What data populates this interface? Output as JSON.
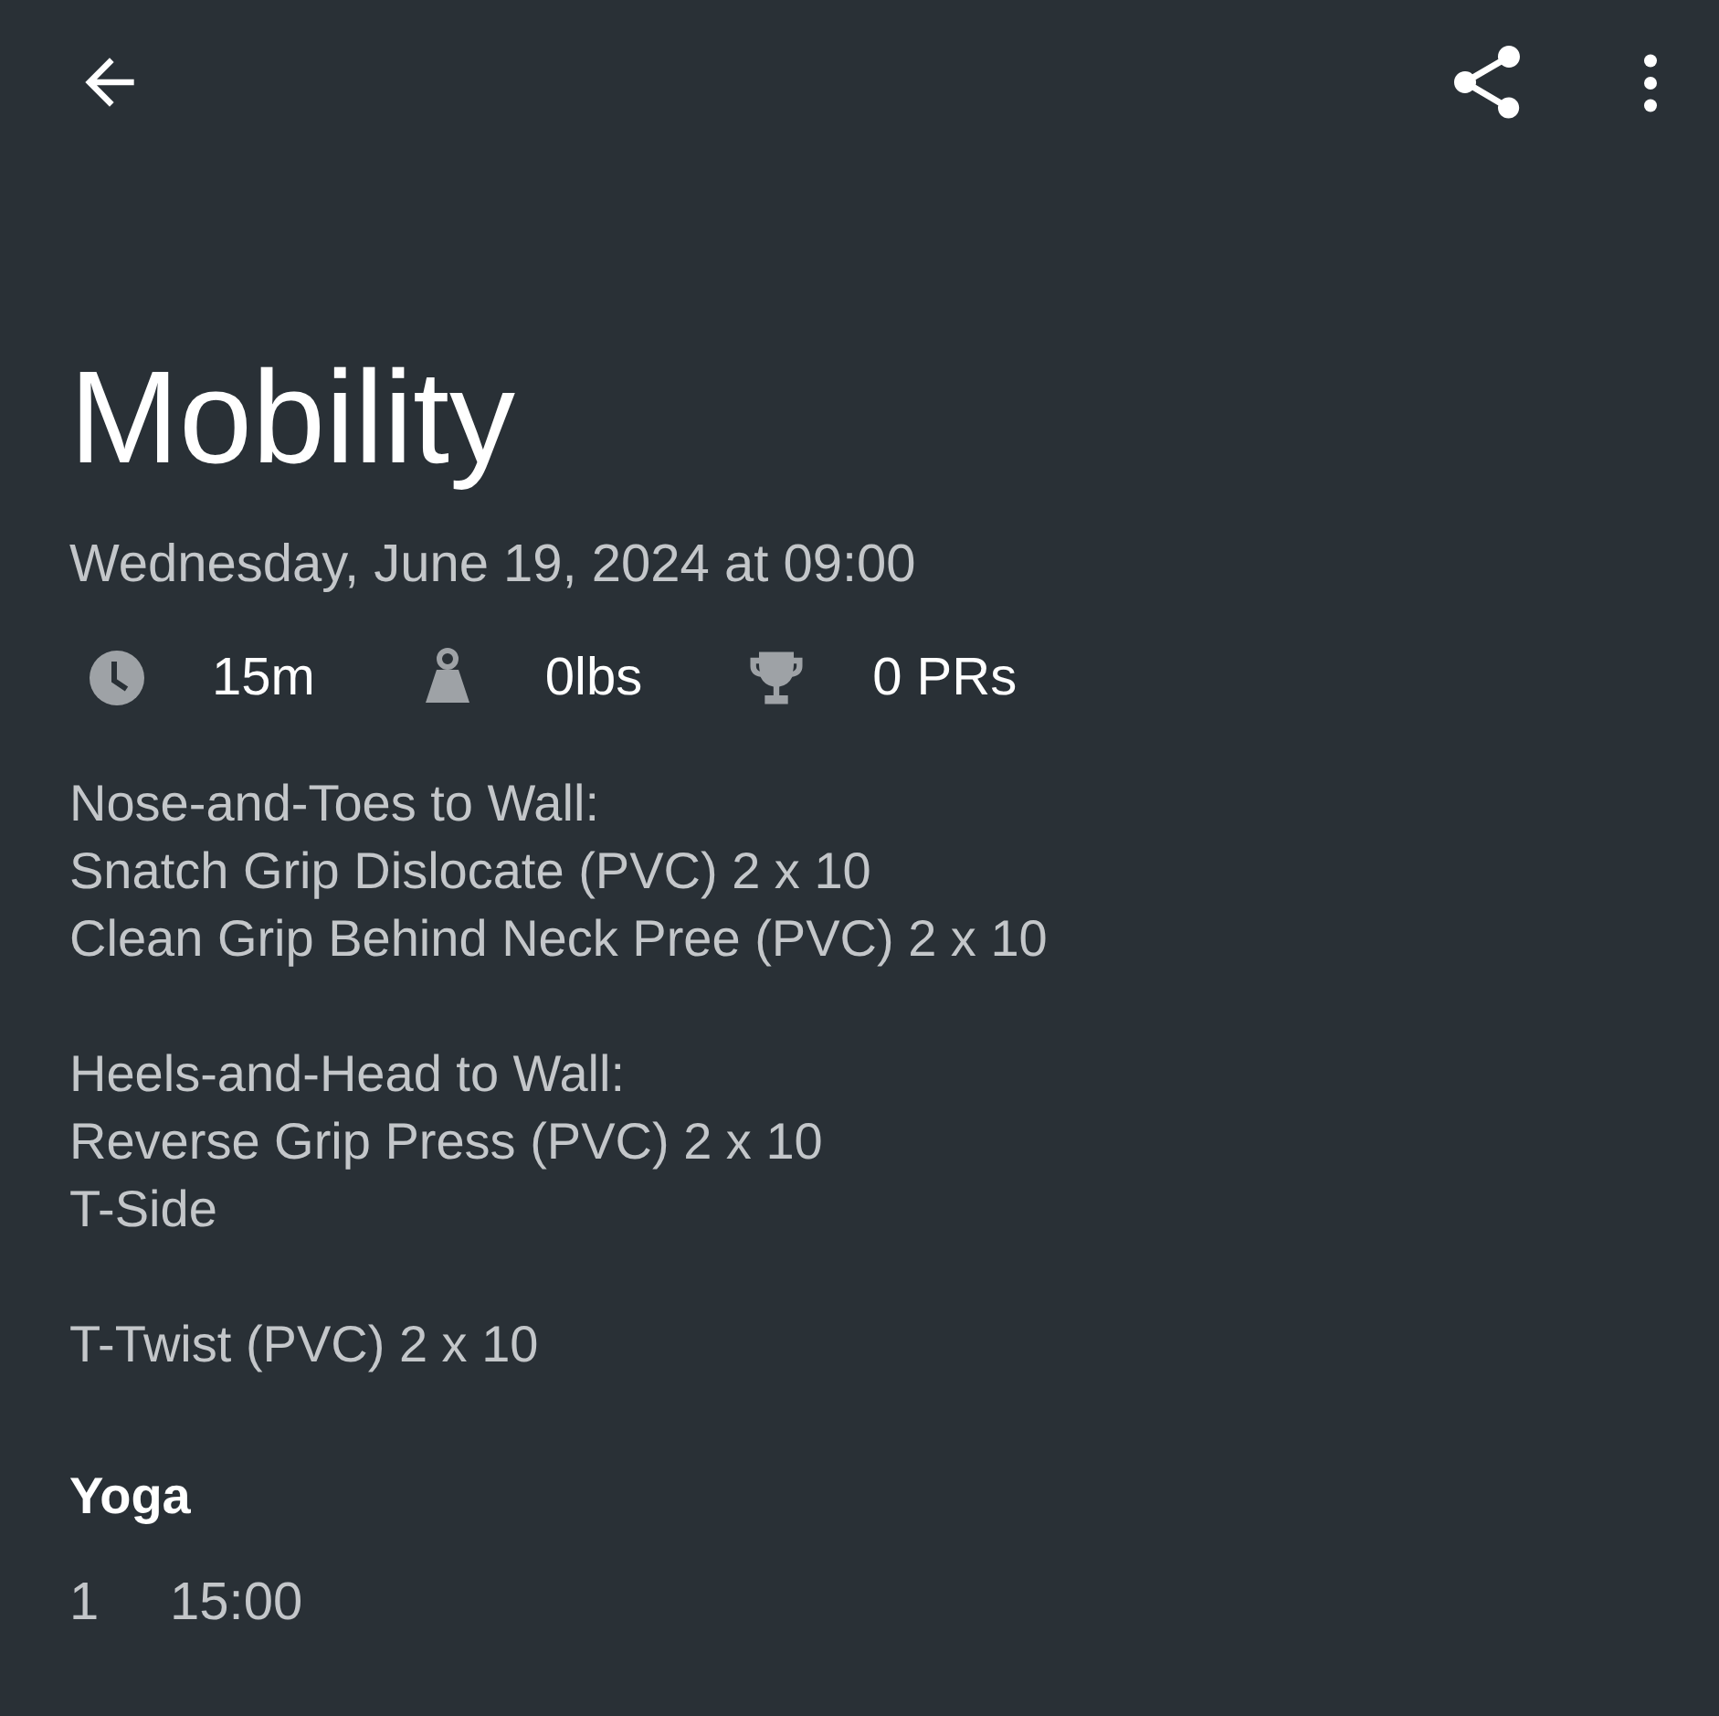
{
  "title": "Mobility",
  "date": "Wednesday, June 19, 2024 at 09:00",
  "stats": [
    {
      "kind": "clock",
      "value": "15m"
    },
    {
      "kind": "weight",
      "value": "0lbs"
    },
    {
      "kind": "trophy",
      "value": "0 PRs"
    }
  ],
  "notes": [
    [
      "Nose-and-Toes to Wall:",
      "Snatch Grip Dislocate (PVC) 2 x 10",
      "Clean Grip Behind Neck Pree (PVC) 2 x 10"
    ],
    [
      "Heels-and-Head to Wall:",
      "Reverse Grip Press (PVC) 2 x 10",
      "T-Side"
    ],
    [
      "T-Twist (PVC) 2 x 10"
    ]
  ],
  "exercises": [
    {
      "name": "Yoga",
      "sets": [
        {
          "number": "1",
          "time": "15:00"
        }
      ]
    }
  ]
}
